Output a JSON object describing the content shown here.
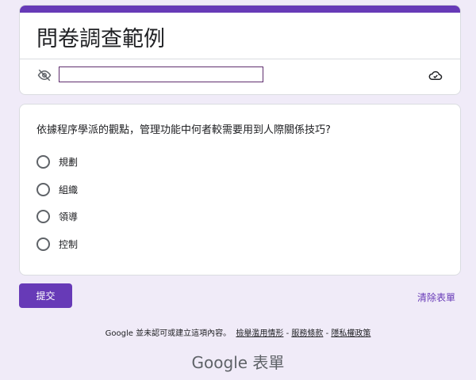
{
  "form": {
    "title": "問卷調查範例",
    "email_value": ""
  },
  "question": {
    "text": "依據程序學派的觀點，管理功能中何者較需要用到人際關係技巧?",
    "options": [
      "規劃",
      "組織",
      "領導",
      "控制"
    ]
  },
  "actions": {
    "submit": "提交",
    "clear": "清除表單"
  },
  "footer": {
    "disclaimer": "Google 並未認可或建立這項內容。",
    "report": "檢舉濫用情形",
    "sep": " - ",
    "terms": "服務條款",
    "privacy": "隱私權政策"
  },
  "logo": {
    "text": "Google 表單"
  },
  "colors": {
    "accent": "#673ab7",
    "background": "#f0ebf8"
  }
}
